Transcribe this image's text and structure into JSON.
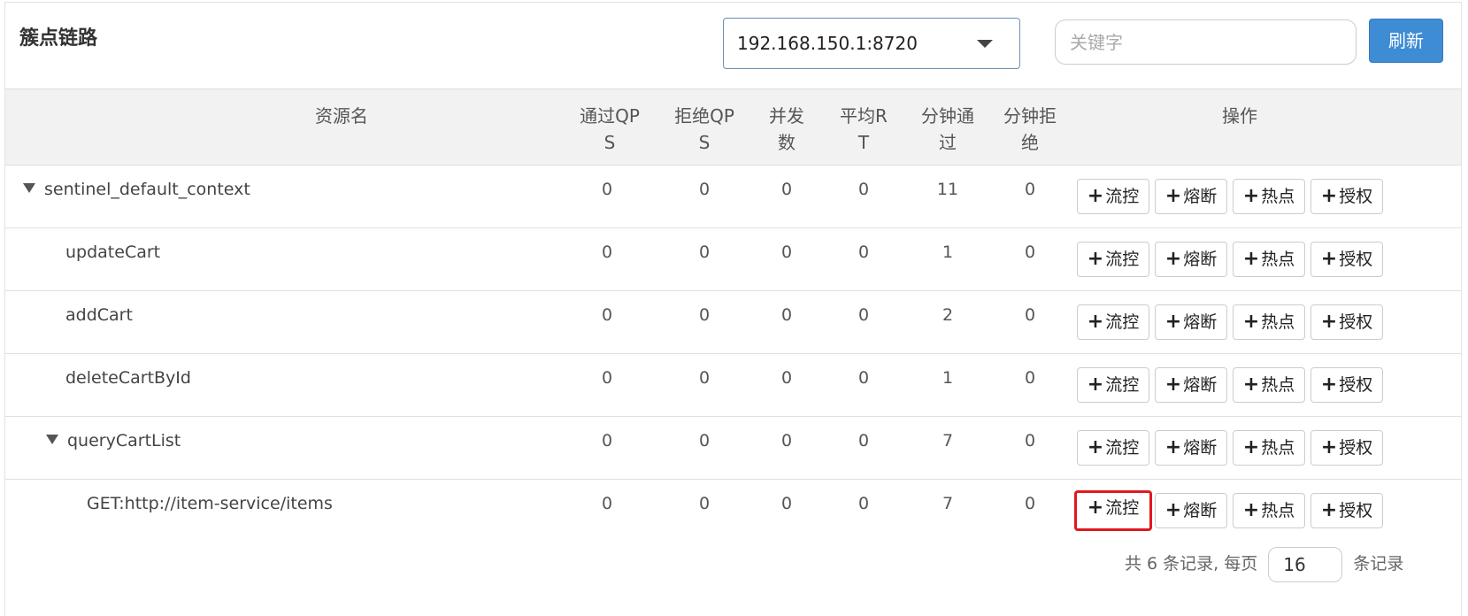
{
  "panel": {
    "title": "簇点链路"
  },
  "toolbar": {
    "machine_select_value": "192.168.150.1:8720",
    "keyword_placeholder": "关键字",
    "refresh_label": "刷新"
  },
  "table": {
    "headers": {
      "resource": "资源名",
      "pass_qps": [
        "通过QP",
        "S"
      ],
      "block_qps": [
        "拒绝QP",
        "S"
      ],
      "concurrency": [
        "并发",
        "数"
      ],
      "avg_rt": [
        "平均R",
        "T"
      ],
      "minute_pass": [
        "分钟通",
        "过"
      ],
      "minute_block": [
        "分钟拒",
        "绝"
      ],
      "actions": "操作"
    },
    "rows": [
      {
        "name": "sentinel_default_context",
        "pass_qps": "0",
        "block_qps": "0",
        "concurrency": "0",
        "avg_rt": "0",
        "minute_pass": "11",
        "minute_block": "0"
      },
      {
        "name": "updateCart",
        "pass_qps": "0",
        "block_qps": "0",
        "concurrency": "0",
        "avg_rt": "0",
        "minute_pass": "1",
        "minute_block": "0"
      },
      {
        "name": "addCart",
        "pass_qps": "0",
        "block_qps": "0",
        "concurrency": "0",
        "avg_rt": "0",
        "minute_pass": "2",
        "minute_block": "0"
      },
      {
        "name": "deleteCartById",
        "pass_qps": "0",
        "block_qps": "0",
        "concurrency": "0",
        "avg_rt": "0",
        "minute_pass": "1",
        "minute_block": "0"
      },
      {
        "name": "queryCartList",
        "pass_qps": "0",
        "block_qps": "0",
        "concurrency": "0",
        "avg_rt": "0",
        "minute_pass": "7",
        "minute_block": "0"
      },
      {
        "name": "GET:http://item-service/items",
        "pass_qps": "0",
        "block_qps": "0",
        "concurrency": "0",
        "avg_rt": "0",
        "minute_pass": "7",
        "minute_block": "0"
      }
    ],
    "action_labels": {
      "flow": "流控",
      "degrade": "熔断",
      "hotspot": "热点",
      "auth": "授权"
    }
  },
  "pagination": {
    "summary_prefix": "共 6 条记录, 每页",
    "page_size": "16",
    "summary_suffix": "条记录"
  }
}
